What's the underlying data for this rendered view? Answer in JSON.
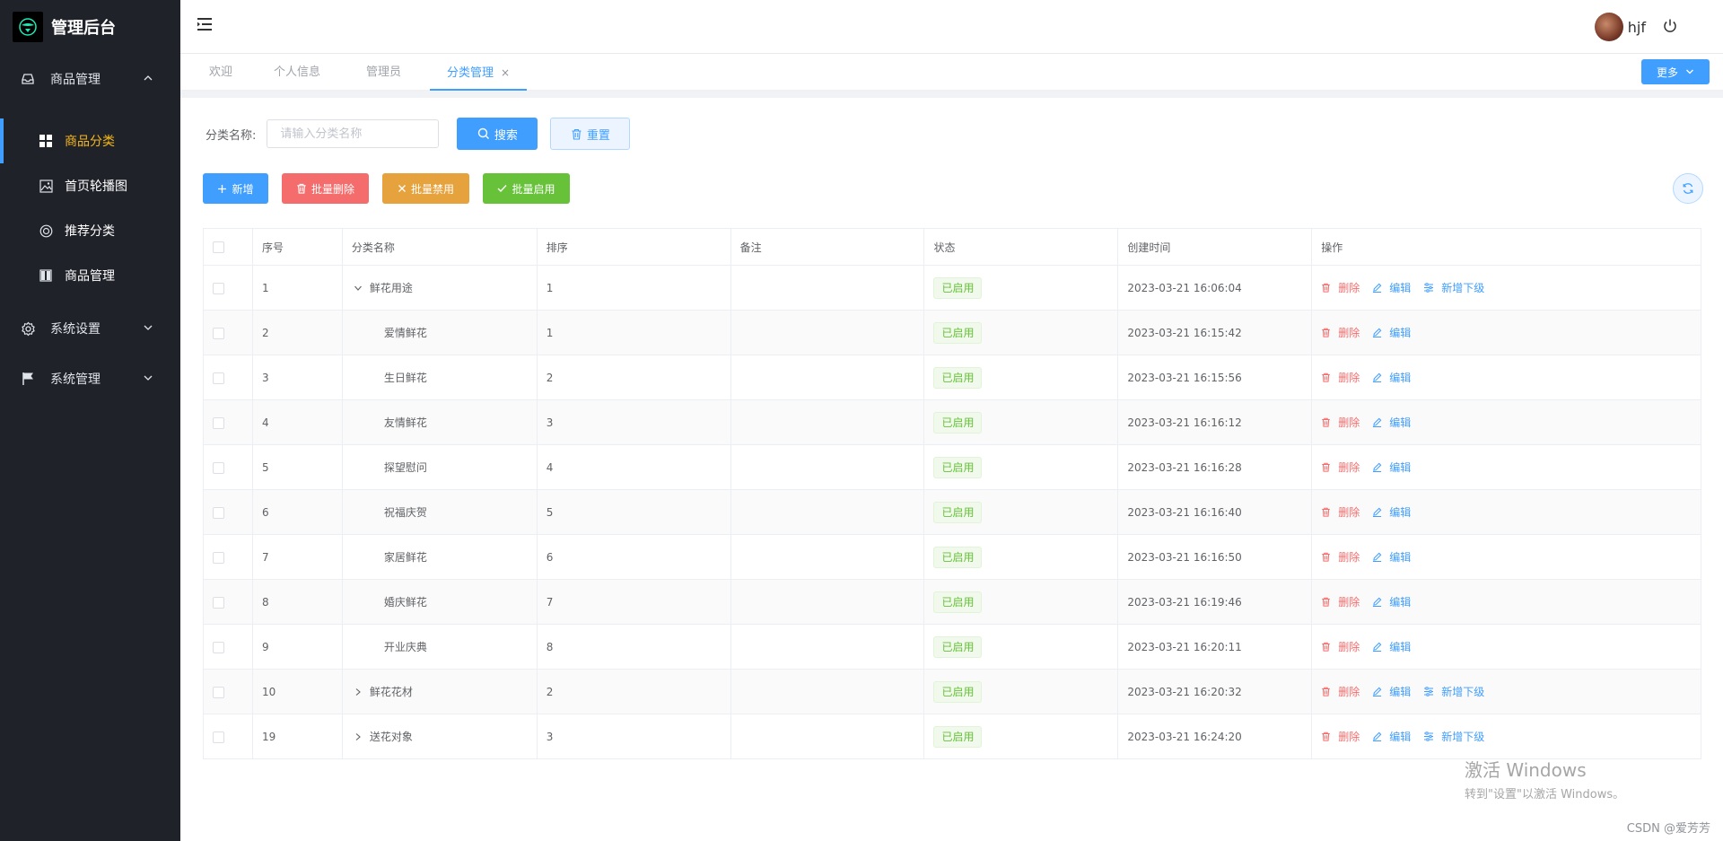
{
  "app": {
    "title": "管理后台"
  },
  "sidebar": {
    "groups": [
      {
        "label": "商品管理",
        "icon": "inbox-icon",
        "expanded": true
      },
      {
        "label": "系统设置",
        "icon": "gear-icon",
        "expanded": false
      },
      {
        "label": "系统管理",
        "icon": "flag-icon",
        "expanded": false
      }
    ],
    "items": [
      {
        "label": "商品分类",
        "icon": "grid-icon",
        "active": true
      },
      {
        "label": "首页轮播图",
        "icon": "image-icon",
        "active": false
      },
      {
        "label": "推荐分类",
        "icon": "lifebuoy-icon",
        "active": false
      },
      {
        "label": "商品管理",
        "icon": "book-icon",
        "active": false
      }
    ]
  },
  "header": {
    "username": "hjf"
  },
  "tabs": {
    "items": [
      {
        "label": "欢迎",
        "active": false
      },
      {
        "label": "个人信息",
        "active": false
      },
      {
        "label": "管理员",
        "active": false
      },
      {
        "label": "分类管理",
        "active": true,
        "close": "×"
      }
    ],
    "more_label": "更多"
  },
  "search": {
    "label": "分类名称:",
    "placeholder": "请输入分类名称",
    "search_label": "搜索",
    "reset_label": "重置"
  },
  "actions": {
    "add": "新增",
    "batch_delete": "批量删除",
    "batch_disable": "批量禁用",
    "batch_enable": "批量启用"
  },
  "table": {
    "columns": [
      "序号",
      "分类名称",
      "排序",
      "备注",
      "状态",
      "创建时间",
      "操作"
    ],
    "rows": [
      {
        "id": "1",
        "name": "鲜花用途",
        "sort": "1",
        "note": "",
        "status": "已启用",
        "created": "2023-03-21 16:06:04",
        "level": "parent",
        "expand": "open",
        "ops": [
          "删除",
          "编辑",
          "新增下级"
        ]
      },
      {
        "id": "2",
        "name": "爱情鲜花",
        "sort": "1",
        "note": "",
        "status": "已启用",
        "created": "2023-03-21 16:15:42",
        "level": "child",
        "ops": [
          "删除",
          "编辑"
        ]
      },
      {
        "id": "3",
        "name": "生日鲜花",
        "sort": "2",
        "note": "",
        "status": "已启用",
        "created": "2023-03-21 16:15:56",
        "level": "child",
        "ops": [
          "删除",
          "编辑"
        ]
      },
      {
        "id": "4",
        "name": "友情鲜花",
        "sort": "3",
        "note": "",
        "status": "已启用",
        "created": "2023-03-21 16:16:12",
        "level": "child",
        "ops": [
          "删除",
          "编辑"
        ]
      },
      {
        "id": "5",
        "name": "探望慰问",
        "sort": "4",
        "note": "",
        "status": "已启用",
        "created": "2023-03-21 16:16:28",
        "level": "child",
        "ops": [
          "删除",
          "编辑"
        ]
      },
      {
        "id": "6",
        "name": "祝福庆贺",
        "sort": "5",
        "note": "",
        "status": "已启用",
        "created": "2023-03-21 16:16:40",
        "level": "child",
        "ops": [
          "删除",
          "编辑"
        ]
      },
      {
        "id": "7",
        "name": "家居鲜花",
        "sort": "6",
        "note": "",
        "status": "已启用",
        "created": "2023-03-21 16:16:50",
        "level": "child",
        "ops": [
          "删除",
          "编辑"
        ]
      },
      {
        "id": "8",
        "name": "婚庆鲜花",
        "sort": "7",
        "note": "",
        "status": "已启用",
        "created": "2023-03-21 16:19:46",
        "level": "child",
        "ops": [
          "删除",
          "编辑"
        ]
      },
      {
        "id": "9",
        "name": "开业庆典",
        "sort": "8",
        "note": "",
        "status": "已启用",
        "created": "2023-03-21 16:20:11",
        "level": "child",
        "ops": [
          "删除",
          "编辑"
        ]
      },
      {
        "id": "10",
        "name": "鲜花花材",
        "sort": "2",
        "note": "",
        "status": "已启用",
        "created": "2023-03-21 16:20:32",
        "level": "parent",
        "expand": "closed",
        "ops": [
          "删除",
          "编辑",
          "新增下级"
        ]
      },
      {
        "id": "19",
        "name": "送花对象",
        "sort": "3",
        "note": "",
        "status": "已启用",
        "created": "2023-03-21 16:24:20",
        "level": "parent",
        "expand": "closed",
        "ops": [
          "删除",
          "编辑",
          "新增下级"
        ]
      }
    ]
  },
  "watermark": {
    "title": "激活 Windows",
    "subtitle": "转到\"设置\"以激活 Windows。"
  },
  "footer": {
    "credit": "CSDN @爱芳芳"
  },
  "colors": {
    "primary": "#409eff",
    "danger": "#f56c6c",
    "warning": "#e6a23c",
    "success": "#67c23a",
    "sidebar": "#20222a",
    "active_menu": "#f5b71b"
  }
}
